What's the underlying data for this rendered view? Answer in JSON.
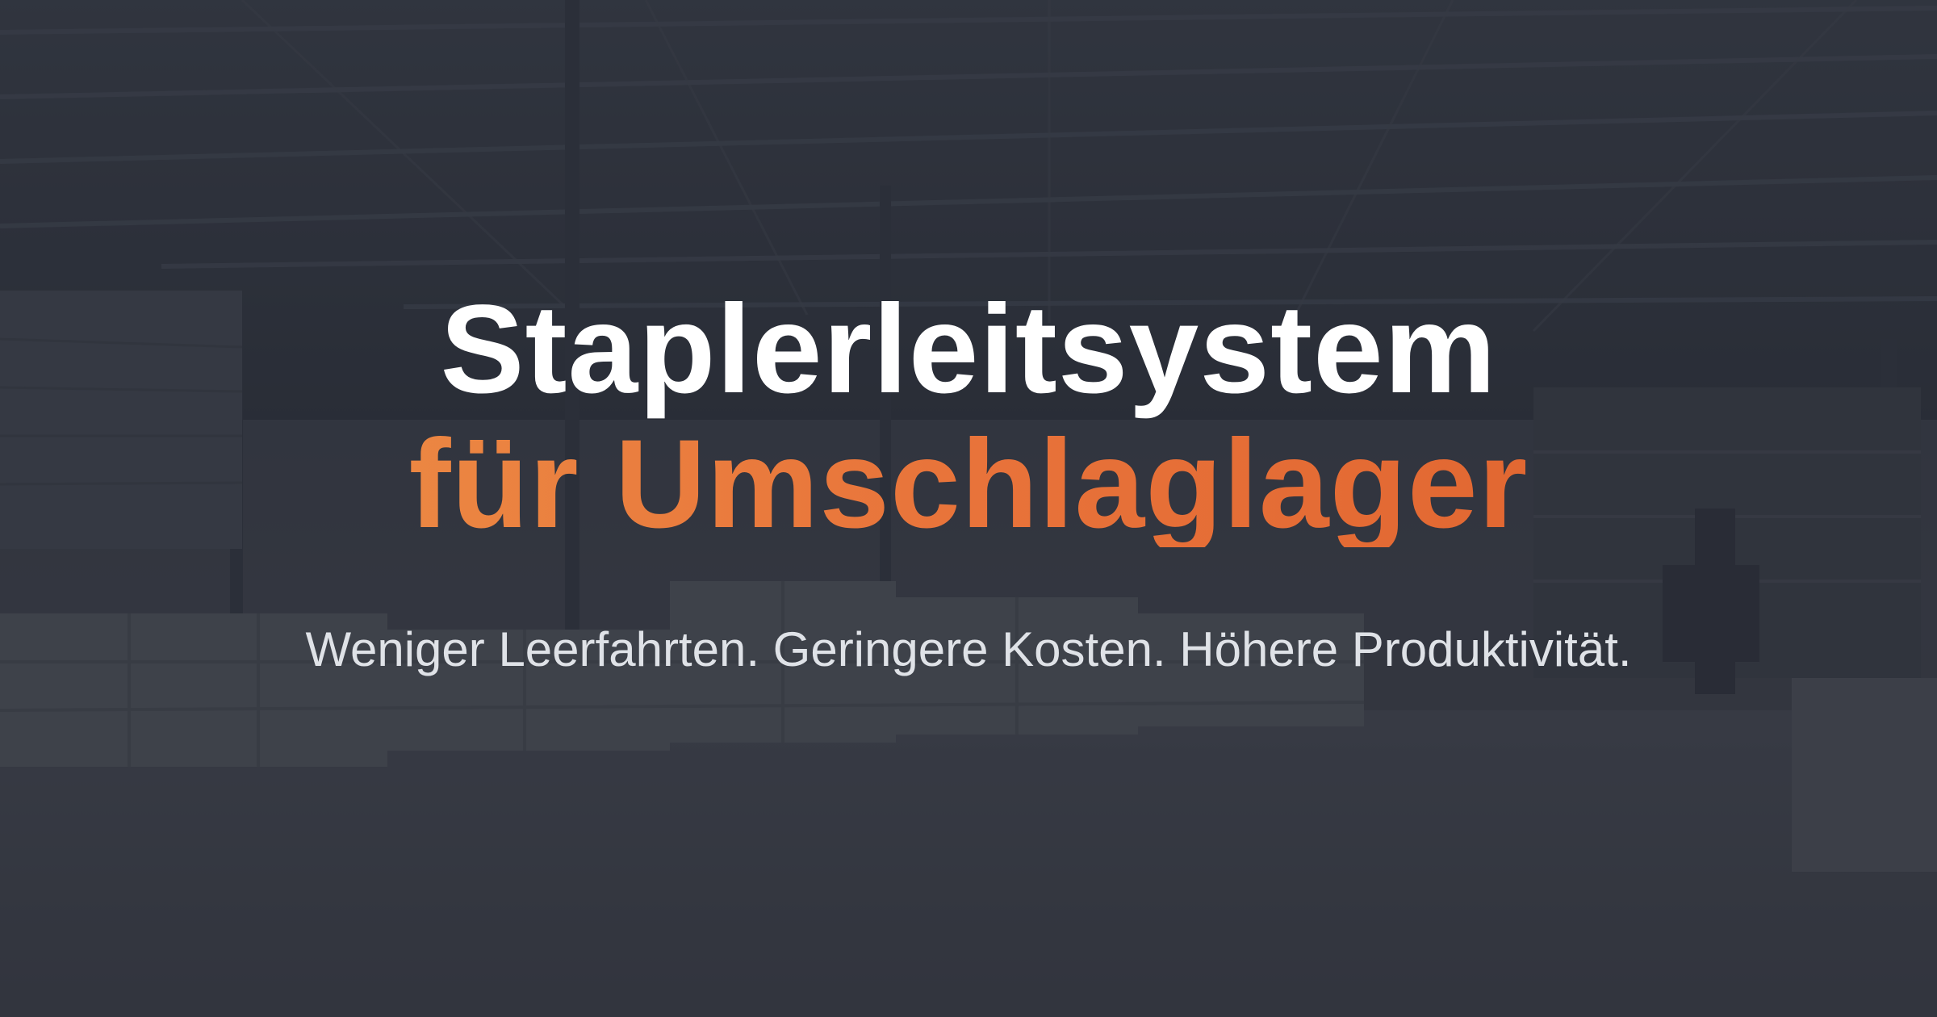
{
  "hero": {
    "title_line1": "Staplerleitsystem",
    "title_line2": "für Umschlaglager",
    "tagline": "Weniger Leerfahrten. Geringere Kosten. Höhere Produktivität."
  },
  "colors": {
    "title_white": "#ffffff",
    "accent_orange_start": "#ee9448",
    "accent_orange_end": "#dd5f2c",
    "tagline_gray": "#dfe2e7",
    "overlay": "#282c36"
  },
  "background": {
    "subject": "warehouse interior"
  }
}
